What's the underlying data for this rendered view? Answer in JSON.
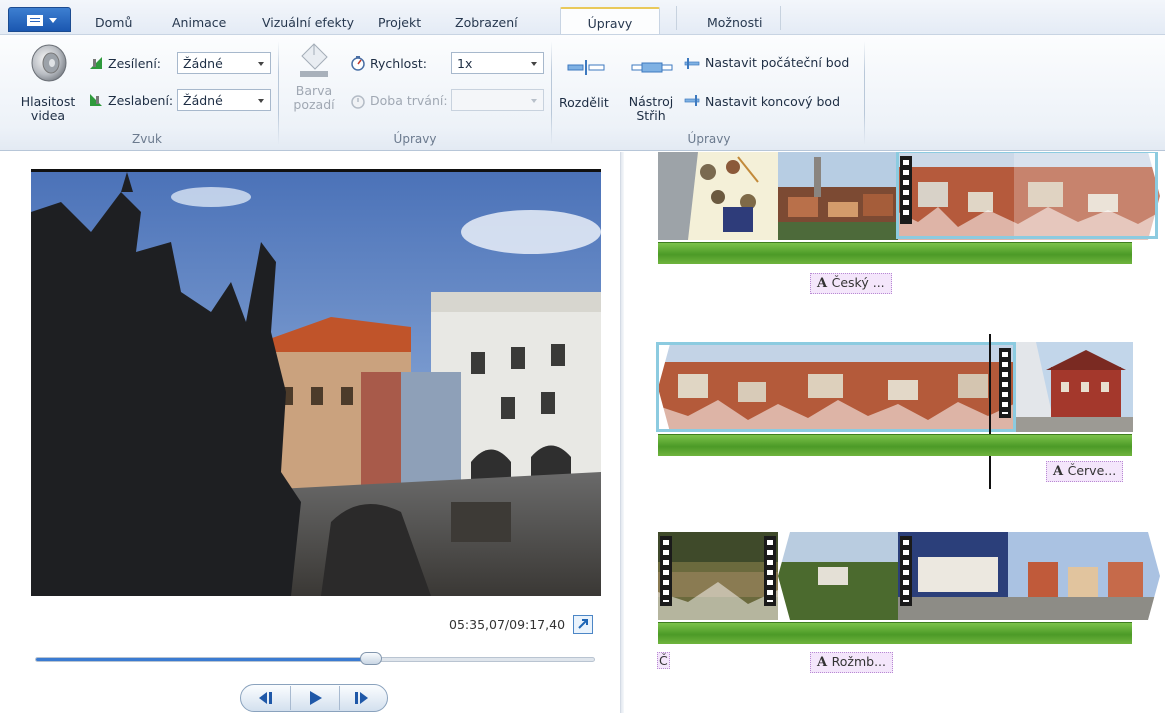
{
  "tabs": {
    "home": "Domů",
    "animations": "Animace",
    "visual_effects": "Vizuální efekty",
    "project": "Projekt",
    "view": "Zobrazení",
    "edit": "Úpravy",
    "options": "Možnosti"
  },
  "ribbon": {
    "video_volume": "Hlasitost videa",
    "fade_in_label": "Zesílení:",
    "fade_in_value": "Žádné",
    "fade_out_label": "Zeslabení:",
    "fade_out_value": "Žádné",
    "group_sound": "Zvuk",
    "background_color": "Barva pozadí",
    "speed_label": "Rychlost:",
    "speed_value": "1x",
    "duration_label": "Doba trvání:",
    "duration_value": "",
    "group_adjust": "Úpravy",
    "split": "Rozdělit",
    "trim_tool": "Nástroj Střih",
    "set_start": "Nastavit počáteční bod",
    "set_end": "Nastavit koncový bod",
    "group_edit": "Úpravy"
  },
  "preview": {
    "timecode": "05:35,07/09:17,40",
    "progress": 0.6
  },
  "storyboard": {
    "caption_1": "Český ...",
    "caption_2": "Červe...",
    "caption_3": "Rožmb...",
    "stray_char": "Č"
  },
  "colors": {
    "accent": "#3b7bd1",
    "selection": "#8ccbe0",
    "audio": "#4c9a27",
    "caption_bg": "#f4e6fb"
  }
}
